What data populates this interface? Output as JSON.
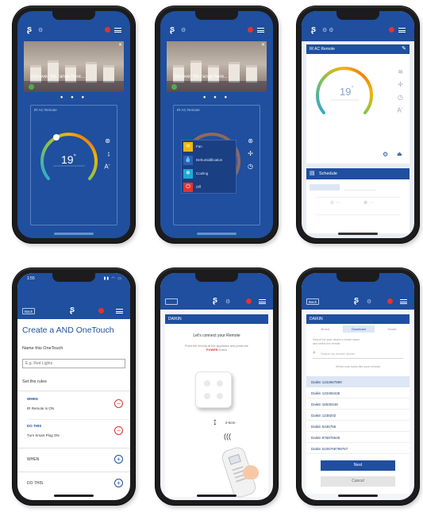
{
  "phone1": {
    "banner_title": "Discover the range here...",
    "card_title": "IR AC Remote",
    "temperature": "19",
    "temp_unit": "°"
  },
  "phone2": {
    "banner_title": "Discover the range here...",
    "card_title": "IR AC Remote",
    "modes": [
      "Fan",
      "Dehumidification",
      "Cooling",
      "Off"
    ]
  },
  "phone3": {
    "header": "IR AC Remote",
    "temperature": "19",
    "temp_unit": "°",
    "schedule_label": "Schedule"
  },
  "phone4": {
    "status_time": "1:55",
    "back_label": "Back",
    "title": "Create a AND OneTouch",
    "name_label": "Name this OneTouch",
    "name_placeholder": "E.g. Red Lights",
    "rules_label": "Set the rules",
    "when_title": "WHEN",
    "when_value": "IR Remote is ON",
    "dothis_title": "DO THIS",
    "dothis_value": "Turn Smart Plug ON",
    "when_add_label": "WHEN",
    "dothis_add_label": "DO THIS"
  },
  "phone5": {
    "header": "DAIKIN",
    "connect_title": "Let's connect your Remote",
    "instruction": "Point the remote at the appliance and press the POWER button",
    "highlight_word": "POWER",
    "distance_label": "2-5cm"
  },
  "phone6": {
    "back_label": "Back",
    "header": "DAIKIN",
    "tabs": [
      "Brand",
      "Download",
      "Model"
    ],
    "search_placeholder": "Search by device model",
    "hint": "Which one looks like your remote",
    "models": [
      "Daikin 1234567890",
      "Daikin 123456435",
      "Daikin 16530246",
      "Daikin 1238202",
      "Daikin 5436756",
      "Daikin 876876645",
      "Daikin 5105768798767"
    ],
    "next_label": "Next",
    "cancel_label": "Cancel"
  }
}
